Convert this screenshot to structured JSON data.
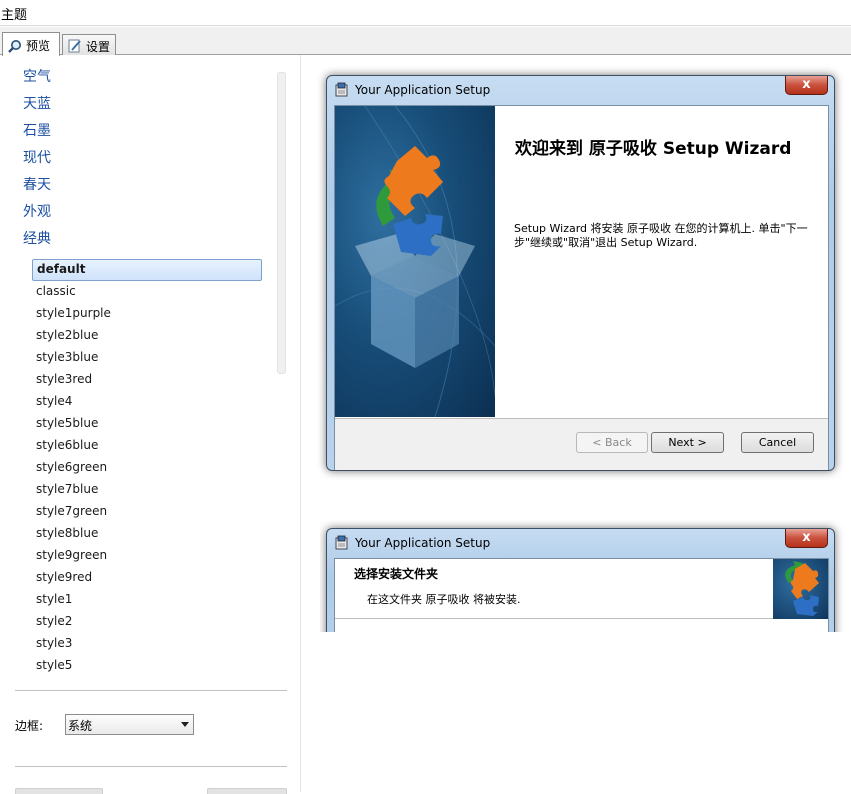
{
  "window": {
    "title": "主题"
  },
  "tabs": [
    {
      "label": "预览",
      "icon": "magnifier-icon"
    },
    {
      "label": "设置",
      "icon": "pencil-icon"
    }
  ],
  "themes": [
    "空气",
    "天蓝",
    "石墨",
    "现代",
    "春天",
    "外观",
    "经典"
  ],
  "styles": {
    "selected": "default",
    "items": [
      "default",
      "classic",
      "style1purple",
      "style2blue",
      "style3blue",
      "style3red",
      "style4",
      "style5blue",
      "style6blue",
      "style6green",
      "style7blue",
      "style7green",
      "style8blue",
      "style9green",
      "style9red",
      "style1",
      "style2",
      "style3",
      "style5"
    ]
  },
  "border": {
    "label": "边框:",
    "value": "系统"
  },
  "preview_welcome": {
    "caption": "Your Application Setup",
    "close_glyph": "x",
    "heading": "欢迎来到 原子吸收 Setup Wizard",
    "body": "Setup Wizard 将安装 原子吸收 在您的计算机上. 单击\"下一步\"继续或\"取消\"退出 Setup Wizard.",
    "back_label": "< Back",
    "next_label": "Next >",
    "cancel_label": "Cancel"
  },
  "preview_folder": {
    "caption": "Your Application Setup",
    "close_glyph": "x",
    "heading": "选择安装文件夹",
    "subtitle": "在这文件夹 原子吸收 将被安装."
  },
  "colors": {
    "link": "#1e50a2",
    "selection": "#cfe3fb",
    "close_button": "#c9513c",
    "banner": "#174d78"
  }
}
